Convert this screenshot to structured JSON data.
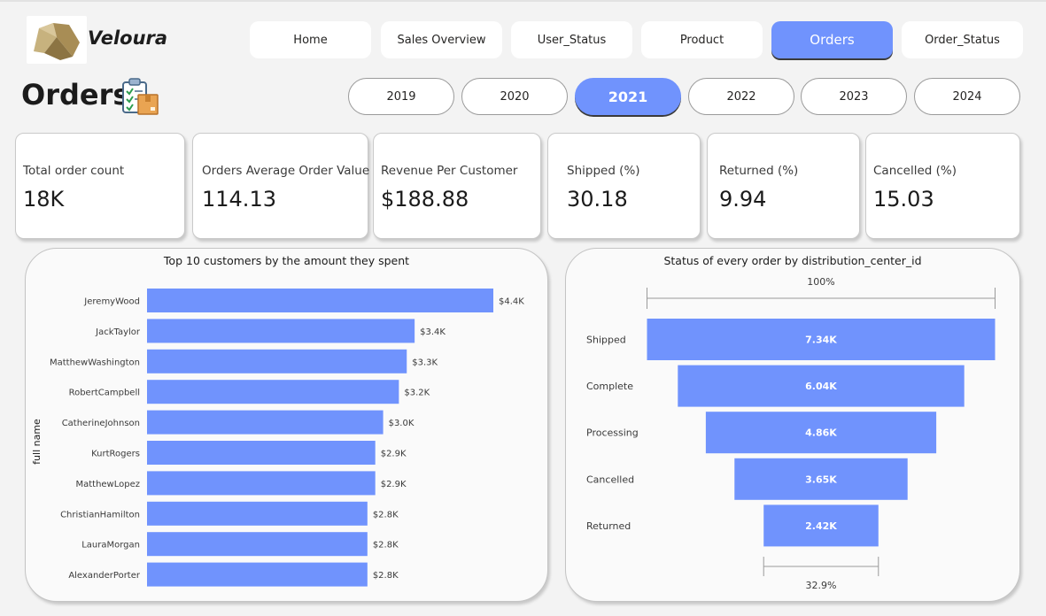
{
  "brand": {
    "name": "Veloura"
  },
  "nav": {
    "items": [
      {
        "label": "Home",
        "active": false
      },
      {
        "label": "Sales Overview",
        "active": false
      },
      {
        "label": "User_Status",
        "active": false
      },
      {
        "label": "Product",
        "active": false
      },
      {
        "label": "Orders",
        "active": true
      },
      {
        "label": "Order_Status",
        "active": false
      }
    ]
  },
  "page": {
    "title": "Orders",
    "title_icon": "clipboard-package-icon"
  },
  "years": {
    "items": [
      {
        "label": "2019",
        "active": false
      },
      {
        "label": "2020",
        "active": false
      },
      {
        "label": "2021",
        "active": true
      },
      {
        "label": "2022",
        "active": false
      },
      {
        "label": "2023",
        "active": false
      },
      {
        "label": "2024",
        "active": false
      }
    ]
  },
  "kpis": [
    {
      "label": "Total order count",
      "value": "18K"
    },
    {
      "label": "Orders Average Order Value",
      "value": "114.13"
    },
    {
      "label": "Revenue Per Customer",
      "value": "$188.88"
    },
    {
      "label": "Shipped (%)",
      "value": "30.18"
    },
    {
      "label": "Returned (%)",
      "value": "9.94"
    },
    {
      "label": "Cancelled (%)",
      "value": "15.03"
    }
  ],
  "colors": {
    "accent": "#7093fd",
    "bar": "#7093fd",
    "background": "#f3f3f3",
    "card": "#ffffff"
  },
  "chart_data": [
    {
      "type": "bar",
      "orientation": "horizontal",
      "title": "Top 10 customers by the amount they spent",
      "ylabel": "full name",
      "categories": [
        "JeremyWood",
        "JackTaylor",
        "MatthewWashington",
        "RobertCampbell",
        "CatherineJohnson",
        "KurtRogers",
        "MatthewLopez",
        "ChristianHamilton",
        "LauraMorgan",
        "AlexanderPorter"
      ],
      "values": [
        4400,
        3400,
        3300,
        3200,
        3000,
        2900,
        2900,
        2800,
        2800,
        2800
      ],
      "data_labels": [
        "$4.4K",
        "$3.4K",
        "$3.3K",
        "$3.2K",
        "$3.0K",
        "$2.9K",
        "$2.9K",
        "$2.8K",
        "$2.8K",
        "$2.8K"
      ],
      "xlim": [
        0,
        4400
      ]
    },
    {
      "type": "funnel",
      "title": "Status of every order by distribution_center_id",
      "categories": [
        "Shipped",
        "Complete",
        "Processing",
        "Cancelled",
        "Returned"
      ],
      "values": [
        7340,
        6040,
        4860,
        3650,
        2420
      ],
      "data_labels": [
        "7.34K",
        "6.04K",
        "4.86K",
        "3.65K",
        "2.42K"
      ],
      "top_percent_label": "100%",
      "bottom_percent_label": "32.9%"
    }
  ]
}
